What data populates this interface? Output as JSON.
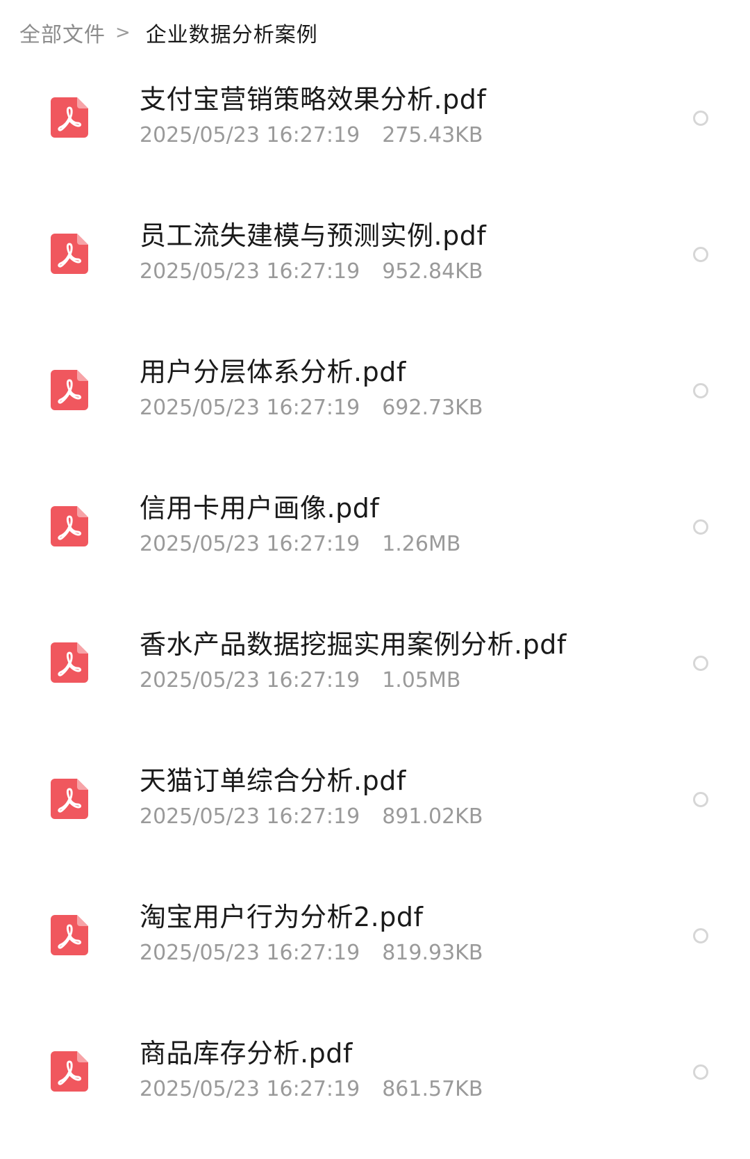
{
  "breadcrumb": {
    "root": "全部文件",
    "separator": ">",
    "current": "企业数据分析案例"
  },
  "icon": {
    "name": "pdf-file-icon",
    "color": "#f0575e"
  },
  "files": [
    {
      "name": "支付宝营销策略效果分析.pdf",
      "date": "2025/05/23 16:27:19",
      "size": "275.43KB"
    },
    {
      "name": "员工流失建模与预测实例.pdf",
      "date": "2025/05/23 16:27:19",
      "size": "952.84KB"
    },
    {
      "name": "用户分层体系分析.pdf",
      "date": "2025/05/23 16:27:19",
      "size": "692.73KB"
    },
    {
      "name": "信用卡用户画像.pdf",
      "date": "2025/05/23 16:27:19",
      "size": "1.26MB"
    },
    {
      "name": "香水产品数据挖掘实用案例分析.pdf",
      "date": "2025/05/23 16:27:19",
      "size": "1.05MB"
    },
    {
      "name": "天猫订单综合分析.pdf",
      "date": "2025/05/23 16:27:19",
      "size": "891.02KB"
    },
    {
      "name": "淘宝用户行为分析2.pdf",
      "date": "2025/05/23 16:27:19",
      "size": "819.93KB"
    },
    {
      "name": "商品库存分析.pdf",
      "date": "2025/05/23 16:27:19",
      "size": "861.57KB"
    }
  ]
}
